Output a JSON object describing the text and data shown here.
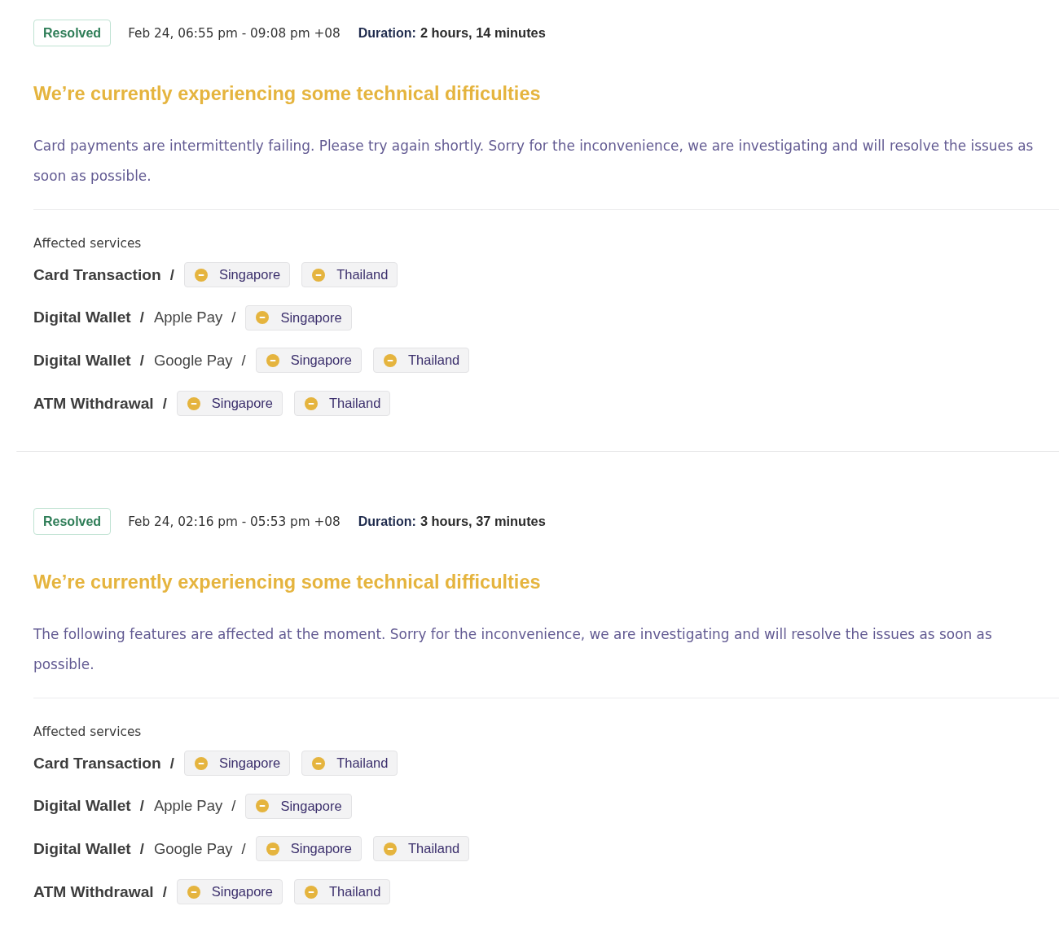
{
  "incidents": [
    {
      "status": {
        "label": "Resolved",
        "kind": "resolved"
      },
      "time_range": "Feb 24, 06:55 pm - 09:08 pm +08",
      "duration_label": "Duration:",
      "duration": "2 hours, 14 minutes",
      "title": "We’re currently experiencing some technical difficulties",
      "description": "Card payments are intermittently failing. Please try again shortly. Sorry for the inconvenience, we are investigating and will resolve the issues as soon as possible.",
      "affected_label": "Affected services",
      "services": [
        {
          "path": [
            {
              "text": "Card Transaction",
              "kind": "group"
            },
            {
              "text": "/",
              "kind": "separator"
            }
          ],
          "regions": [
            {
              "name": "Singapore",
              "kind": "degraded"
            },
            {
              "name": "Thailand",
              "kind": "degraded"
            }
          ]
        },
        {
          "path": [
            {
              "text": "Digital Wallet",
              "kind": "group"
            },
            {
              "text": "/",
              "kind": "separator"
            },
            {
              "text": "Apple Pay",
              "kind": "item"
            },
            {
              "text": "/",
              "kind": "separator"
            }
          ],
          "regions": [
            {
              "name": "Singapore",
              "kind": "degraded"
            }
          ]
        },
        {
          "path": [
            {
              "text": "Digital Wallet",
              "kind": "group"
            },
            {
              "text": "/",
              "kind": "separator"
            },
            {
              "text": "Google Pay",
              "kind": "item"
            },
            {
              "text": "/",
              "kind": "separator"
            }
          ],
          "regions": [
            {
              "name": "Singapore",
              "kind": "degraded"
            },
            {
              "name": "Thailand",
              "kind": "degraded"
            }
          ]
        },
        {
          "path": [
            {
              "text": "ATM Withdrawal",
              "kind": "group"
            },
            {
              "text": "/",
              "kind": "separator"
            }
          ],
          "regions": [
            {
              "name": "Singapore",
              "kind": "degraded"
            },
            {
              "name": "Thailand",
              "kind": "degraded"
            }
          ]
        }
      ]
    },
    {
      "status": {
        "label": "Resolved",
        "kind": "resolved"
      },
      "time_range": "Feb 24, 02:16 pm - 05:53 pm +08",
      "duration_label": "Duration:",
      "duration": "3 hours, 37 minutes",
      "title": "We’re currently experiencing some technical difficulties",
      "description": "The following features are affected at the moment. Sorry for the inconvenience, we are investigating and will resolve the issues as soon as possible.",
      "affected_label": "Affected services",
      "services": [
        {
          "path": [
            {
              "text": "Card Transaction",
              "kind": "group"
            },
            {
              "text": "/",
              "kind": "separator"
            }
          ],
          "regions": [
            {
              "name": "Singapore",
              "kind": "degraded"
            },
            {
              "name": "Thailand",
              "kind": "degraded"
            }
          ]
        },
        {
          "path": [
            {
              "text": "Digital Wallet",
              "kind": "group"
            },
            {
              "text": "/",
              "kind": "separator"
            },
            {
              "text": "Apple Pay",
              "kind": "item"
            },
            {
              "text": "/",
              "kind": "separator"
            }
          ],
          "regions": [
            {
              "name": "Singapore",
              "kind": "degraded"
            }
          ]
        },
        {
          "path": [
            {
              "text": "Digital Wallet",
              "kind": "group"
            },
            {
              "text": "/",
              "kind": "separator"
            },
            {
              "text": "Google Pay",
              "kind": "item"
            },
            {
              "text": "/",
              "kind": "separator"
            }
          ],
          "regions": [
            {
              "name": "Singapore",
              "kind": "degraded"
            },
            {
              "name": "Thailand",
              "kind": "degraded"
            }
          ]
        },
        {
          "path": [
            {
              "text": "ATM Withdrawal",
              "kind": "group"
            },
            {
              "text": "/",
              "kind": "separator"
            }
          ],
          "regions": [
            {
              "name": "Singapore",
              "kind": "degraded"
            },
            {
              "name": "Thailand",
              "kind": "degraded"
            }
          ]
        }
      ]
    }
  ]
}
